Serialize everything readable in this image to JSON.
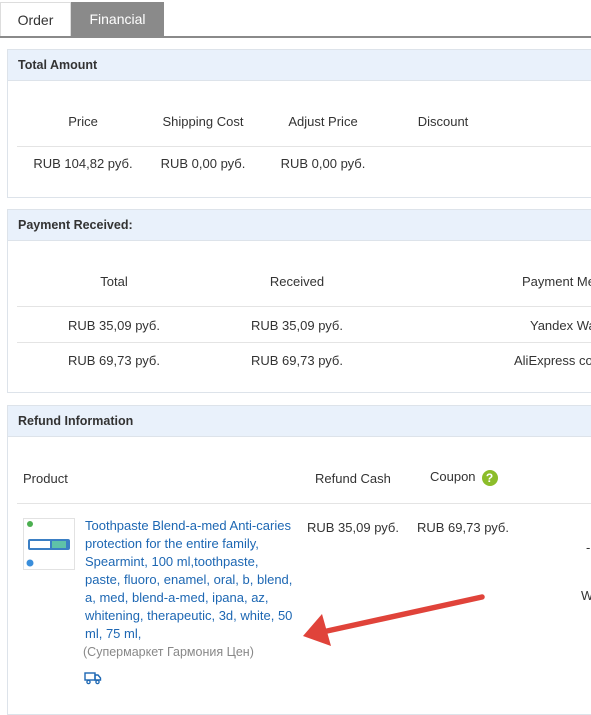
{
  "tabs": [
    {
      "label": "Order"
    },
    {
      "label": "Financial"
    }
  ],
  "total_amount": {
    "title": "Total Amount",
    "headers": [
      "Price",
      "Shipping Cost",
      "Adjust Price",
      "Discount"
    ],
    "values": [
      "RUB 104,82 руб.",
      "RUB 0,00 руб.",
      "RUB 0,00 руб.",
      ""
    ]
  },
  "payment": {
    "title": "Payment Received:",
    "headers": [
      "Total",
      "Received",
      "Payment Me"
    ],
    "rows": [
      [
        "RUB 35,09 руб.",
        "RUB 35,09 руб.",
        "Yandex Wa"
      ],
      [
        "RUB 69,73 руб.",
        "RUB 69,73 руб.",
        "AliExpress co"
      ]
    ]
  },
  "refund": {
    "title": "Refund Information",
    "headers": [
      "Product",
      "Refund Cash",
      "Coupon"
    ],
    "product": {
      "lines": [
        "Toothpaste Blend-a-med Anti-caries",
        "protection for the entire family,",
        "Spearmint, 100 ml,toothpaste,",
        "paste, fluoro, enamel, oral, b, blend,",
        "a, med, blend-a-med, ipana, az,",
        "whitening, therapeutic, 3d, white, 50",
        "ml, 75 ml,"
      ],
      "store": "(Супермаркет Гармония Цен)"
    },
    "refund_cash": "RUB 35,09 руб.",
    "coupon": "RUB 69,73 руб.",
    "edge_glyphs": [
      "-",
      "W"
    ]
  },
  "colors": {
    "accent": "#8a8a8a",
    "link": "#1d67b3",
    "panel_head": "#e9f1fb",
    "arrow": "#e0433a",
    "help": "#8cbd2a"
  }
}
